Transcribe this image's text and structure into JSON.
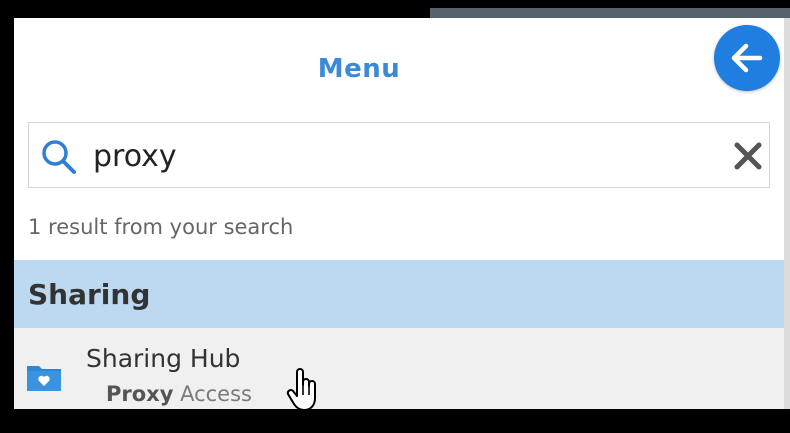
{
  "menu": {
    "title": "Menu"
  },
  "search": {
    "value": "proxy",
    "placeholder": ""
  },
  "results": {
    "count_text": "1 result from your search"
  },
  "section": {
    "title": "Sharing"
  },
  "item": {
    "title": "Sharing Hub",
    "subtitle_match": "Proxy",
    "subtitle_rest": " Access"
  },
  "icons": {
    "back": "arrow-left-icon",
    "search": "search-icon",
    "clear": "close-icon",
    "item": "folder-heart-icon",
    "cursor": "hand-pointer-icon"
  },
  "colors": {
    "accent": "#1f7ee0",
    "title": "#3b8ad9",
    "section_bg": "#bdd9f2",
    "item_bg": "#f0f0f0"
  }
}
